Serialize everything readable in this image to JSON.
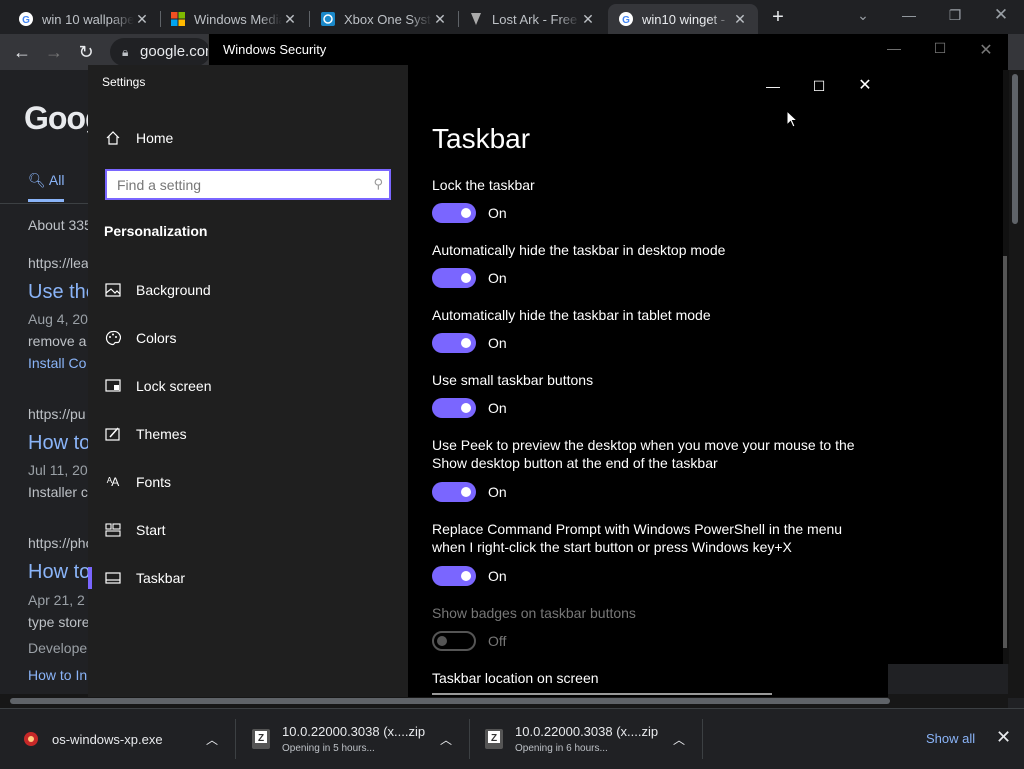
{
  "browser": {
    "tabs": [
      {
        "title": "win 10 wallpape",
        "icon": "google-icon",
        "active": false
      },
      {
        "title": "Windows Media",
        "icon": "microsoft-icon",
        "active": false
      },
      {
        "title": "Xbox One Syste",
        "icon": "xbox-icon",
        "active": false
      },
      {
        "title": "Lost Ark - Free t",
        "icon": "lostark-icon",
        "active": false
      },
      {
        "title": "win10 winget - ",
        "icon": "google-icon",
        "active": true
      }
    ],
    "omnibox_text": "google.com",
    "page": {
      "logo": "Goog",
      "tab_all": "All",
      "about": "About 335",
      "results": [
        {
          "url": "https://lea",
          "title": "Use the",
          "date": "Aug 4, 20",
          "snippet": "remove a",
          "sub": "Install Co"
        },
        {
          "url": "https://pu",
          "title": "How to",
          "date": "Jul 11, 20",
          "snippet": "Installer c",
          "sub": ""
        },
        {
          "url": "https://pho",
          "title": "How to",
          "date": "Apr 21, 2",
          "snippet": "type store",
          "snippet2": "Develope",
          "sub": "How to In"
        }
      ]
    }
  },
  "winsec": {
    "title": "Windows Security"
  },
  "settings": {
    "app_title": "Settings",
    "home_label": "Home",
    "search_placeholder": "Find a setting",
    "section": "Personalization",
    "nav": [
      {
        "label": "Background",
        "icon": "picture-icon"
      },
      {
        "label": "Colors",
        "icon": "palette-icon"
      },
      {
        "label": "Lock screen",
        "icon": "lock-screen-icon"
      },
      {
        "label": "Themes",
        "icon": "brush-icon"
      },
      {
        "label": "Fonts",
        "icon": "font-icon"
      },
      {
        "label": "Start",
        "icon": "start-icon"
      },
      {
        "label": "Taskbar",
        "icon": "taskbar-icon",
        "selected": true
      }
    ],
    "page_title": "Taskbar",
    "options": [
      {
        "label": "Lock the taskbar",
        "state": "On",
        "on": true
      },
      {
        "label": "Automatically hide the taskbar in desktop mode",
        "state": "On",
        "on": true
      },
      {
        "label": "Automatically hide the taskbar in tablet mode",
        "state": "On",
        "on": true
      },
      {
        "label": "Use small taskbar buttons",
        "state": "On",
        "on": true
      },
      {
        "label": "Use Peek to preview the desktop when you move your mouse to the Show desktop button at the end of the taskbar",
        "state": "On",
        "on": true
      },
      {
        "label": "Replace Command Prompt with Windows PowerShell in the menu when I right-click the start button or press Windows key+X",
        "state": "On",
        "on": true
      },
      {
        "label": "Show badges on taskbar buttons",
        "state": "Off",
        "on": false,
        "disabled": true
      }
    ],
    "location_label": "Taskbar location on screen"
  },
  "downloads": {
    "items": [
      {
        "name": "os-windows-xp.exe",
        "status": ""
      },
      {
        "name": "10.0.22000.3038 (x....zip",
        "status": "Opening in 5 hours..."
      },
      {
        "name": "10.0.22000.3038 (x....zip",
        "status": "Opening in 6 hours..."
      }
    ],
    "show_all": "Show all"
  },
  "colors": {
    "accent": "#7a66ff",
    "link": "#8ab4f8",
    "chrome_bg": "#202124"
  }
}
